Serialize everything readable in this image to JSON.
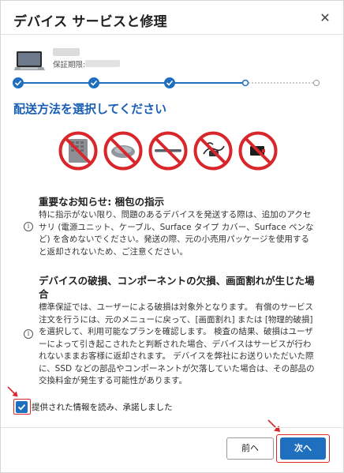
{
  "dialog": {
    "title": "デバイス サービスと修理",
    "close_icon": "close-icon"
  },
  "device": {
    "warranty_label": "保証期限:"
  },
  "stepper": {
    "total_steps": 5,
    "completed_steps": 3,
    "current_step": 4
  },
  "section": {
    "title": "配送方法を選択してください"
  },
  "prohibited_items": [
    {
      "icon": "no-keyboard-cover-icon"
    },
    {
      "icon": "no-mouse-icon"
    },
    {
      "icon": "no-pen-icon"
    },
    {
      "icon": "no-power-supply-icon"
    },
    {
      "icon": "no-accessory-icon"
    }
  ],
  "notice1": {
    "heading": "重要なお知らせ: 梱包の指示",
    "body": "特に指示がない限り、問題のあるデバイスを発送する際は、追加のアクセサリ (電源ユニット、ケーブル、Surface タイプ カバー、Surface ペンなど) を含めないでください。発送の際、元の小売用パッケージを使用すると返却されないため、ご注意ください。"
  },
  "notice2": {
    "heading": "デバイスの破損、コンポーネントの欠損、画面割れが生じた場合",
    "body": "標準保証では、ユーザーによる破損は対象外となります。 有償のサービス注文を行うには、元のメニューに戻って、[画面割れ] または [物理的破損] を選択して、利用可能なプランを確認します。 検査の結果、破損はユーザーによって引き起こされたと判断された場合、デバイスはサービスが行われないままお客様に返却されます。 デバイスを弊社にお送りいただいた際に、SSD などの部品やコンポーネントが欠落していた場合は、その部品の交換料金が発生する可能性があります。"
  },
  "agreement": {
    "label": "提供された情報を読み、承諾しました",
    "checked": true
  },
  "footer": {
    "prev_label": "前へ",
    "next_label": "次へ"
  },
  "colors": {
    "accent": "#1f6fbf",
    "title_blue": "#1a5fb4",
    "prohibit_red": "#d9262b",
    "highlight_red": "#d9262b"
  }
}
